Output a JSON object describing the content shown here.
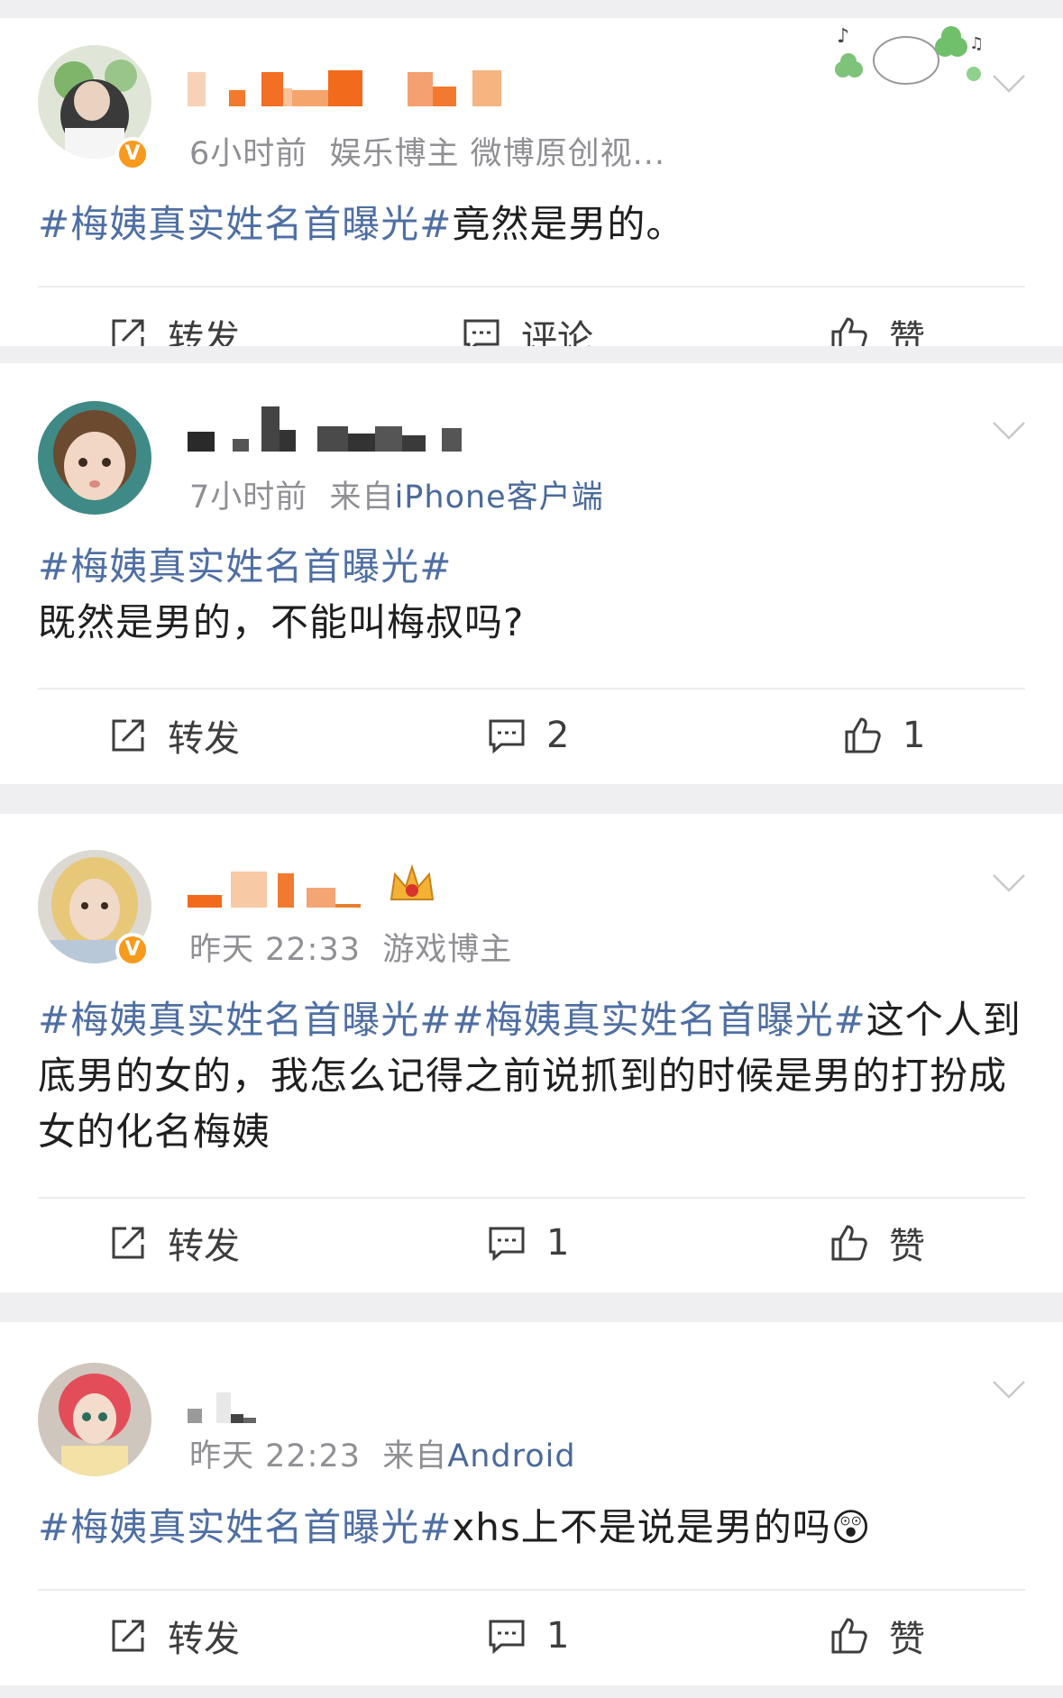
{
  "posts": [
    {
      "meta_time": "6小时前",
      "meta_source": "娱乐博主 微博原创视...",
      "text_topic": "#梅姨真实姓名首曝光#",
      "text_body": "竟然是男的。",
      "actions": {
        "repost": "转发",
        "comment": "评论",
        "like": "赞"
      },
      "verified": "V"
    },
    {
      "meta_time": "7小时前",
      "meta_from": "来自",
      "meta_source": "iPhone客户端",
      "text_topic": "#梅姨真实姓名首曝光#",
      "text_body": "既然是男的，不能叫梅叔吗?",
      "actions": {
        "repost": "转发",
        "comment": "2",
        "like": "1"
      }
    },
    {
      "meta_time": "昨天 22:33",
      "meta_source": "游戏博主",
      "text_topic": "#梅姨真实姓名首曝光##梅姨真实姓名首曝光#",
      "text_body": "这个人到底男的女的，我怎么记得之前说抓到的时候是男的打扮成女的化名梅姨",
      "actions": {
        "repost": "转发",
        "comment": "1",
        "like": "赞"
      },
      "verified": "V"
    },
    {
      "meta_time": "昨天 22:23",
      "meta_from": "来自",
      "meta_source": "Android",
      "text_topic": "#梅姨真实姓名首曝光#",
      "text_body": "xhs上不是说是男的吗",
      "emoji": "😲",
      "actions": {
        "repost": "转发",
        "comment": "1",
        "like": "赞"
      }
    }
  ],
  "colors": {
    "topic": "#4f6fa3",
    "meta": "#8f8f94",
    "badge": "#f79a1e",
    "background": "#efeff1"
  }
}
